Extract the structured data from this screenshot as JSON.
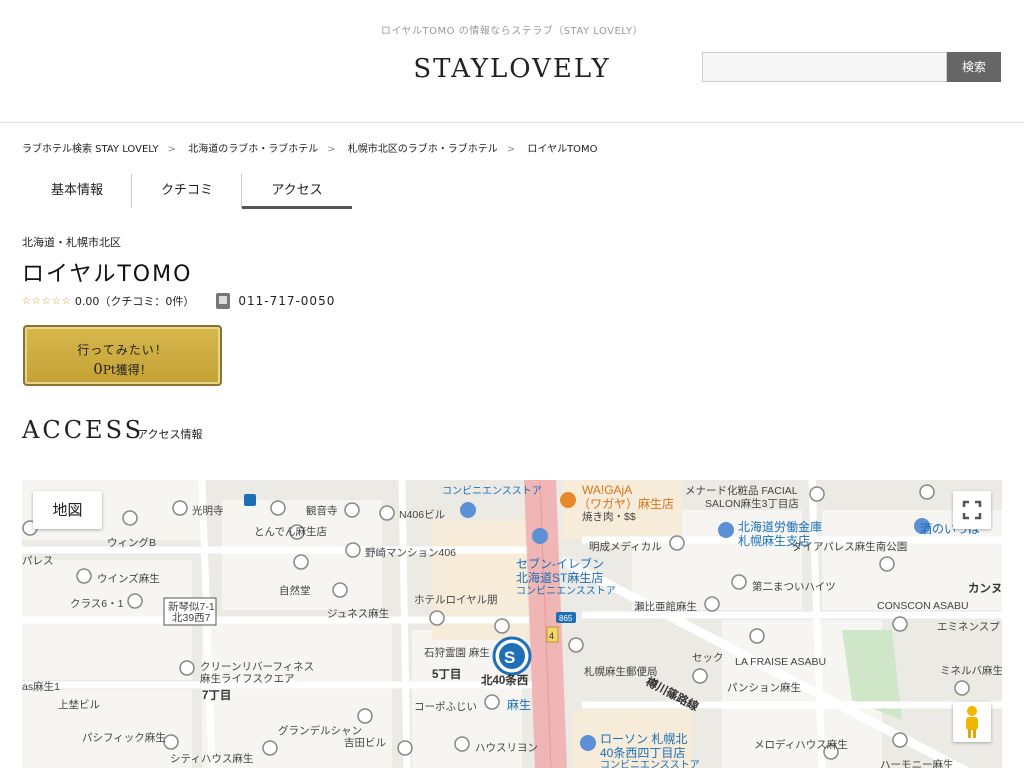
{
  "header": {
    "tagline": "ロイヤルTOMO の情報ならステラブ（STAY LOVELY）",
    "logo": "STAYLOVELY",
    "search_placeholder": "",
    "search_button": "検索"
  },
  "breadcrumb": [
    "ラブホテル検索 STAY LOVELY",
    "北海道のラブホ・ラブホテル",
    "札幌市北区のラブホ・ラブホテル",
    "ロイヤルTOMO"
  ],
  "tabs": [
    {
      "label": "基本情報",
      "active": false
    },
    {
      "label": "クチコミ",
      "active": false
    },
    {
      "label": "アクセス",
      "active": true
    }
  ],
  "hotel": {
    "region": "北海道・札幌市北区",
    "name": "ロイヤルTOMO",
    "stars": "☆☆☆☆☆",
    "rating_text": "0.00（クチコミ：0件）",
    "phone": "011-717-0050"
  },
  "wish_button": {
    "line1": "行ってみたい！",
    "points": "0",
    "line2_suffix": "Pt獲得！"
  },
  "access": {
    "title": "ACCESS",
    "subtitle": "アクセス情報"
  },
  "map": {
    "type_button": "地図",
    "labels": {
      "kobo": "光明寺",
      "kannon": "観音寺",
      "n406": "N406ビル",
      "conv1": "コンビニエンスストア",
      "waigaja": "WA!GAjA",
      "wagaya": "（ワガヤ）麻生店",
      "yakiniku": "焼き肉・$$",
      "menard": "メナード化粧品 FACIAL",
      "salon": "SALON麻生3丁目店",
      "rokin": "北海道労働金庫",
      "rokin2": "札幌麻生支店",
      "sake": "酒のいっぱ",
      "wing": "ウィングB",
      "tonden": "とんでん麻生店",
      "nozaki": "野崎マンション406",
      "meisei": "明成メディカル",
      "diapalace": "ダイアパレス麻生南公園",
      "palace": "パレス",
      "winds": "ウインズ麻生",
      "shizen": "自然堂",
      "seven1": "セブン-イレブン",
      "seven2": "北海道ST麻生店",
      "conv2": "コンビニエンスストア",
      "daini": "第二まついハイツ",
      "kanun": "カンヌ",
      "clas": "クラス6・1",
      "shinkoto": "新琴似7-1",
      "kita39": "北39西7",
      "junes": "ジュネス麻生",
      "hotelroyal": "ホテルロイヤル朋",
      "sebiai": "瀬比亜館麻生",
      "conscon": "CONSCON ASABU",
      "eminence": "エミネンスプ",
      "ishikari": "石狩霊園 麻生",
      "post": "札幌麻生郵便局",
      "sec": "セック",
      "lafraise": "LA FRAISE ASABU",
      "mineruba": "ミネルバ麻生",
      "clean1": "クリーンリバーフィネス",
      "clean2": "麻生ライフスクエア",
      "chome5": "5丁目",
      "kita40": "北40条西",
      "chome7": "7丁目",
      "asabu1": "as麻生1",
      "kamikin": "上埜ビル",
      "corpo": "コーポふじい",
      "asabu_st": "麻生",
      "tarukawa": "樽川篠路線",
      "pension": "パンション麻生",
      "pacific": "パシフィック麻生",
      "grandel": "グランデルシャン",
      "lawson1": "ローソン 札幌北",
      "lawson2": "40条西四丁目店",
      "conv3": "コンビニエンスストア",
      "melody": "メロディハウス麻生",
      "yoshida": "吉田ビル",
      "housryon": "ハウスリヨン",
      "city": "シティハウス麻生",
      "harmony": "ハーモニー麻生",
      "r865": "865",
      "r4": "4"
    }
  }
}
